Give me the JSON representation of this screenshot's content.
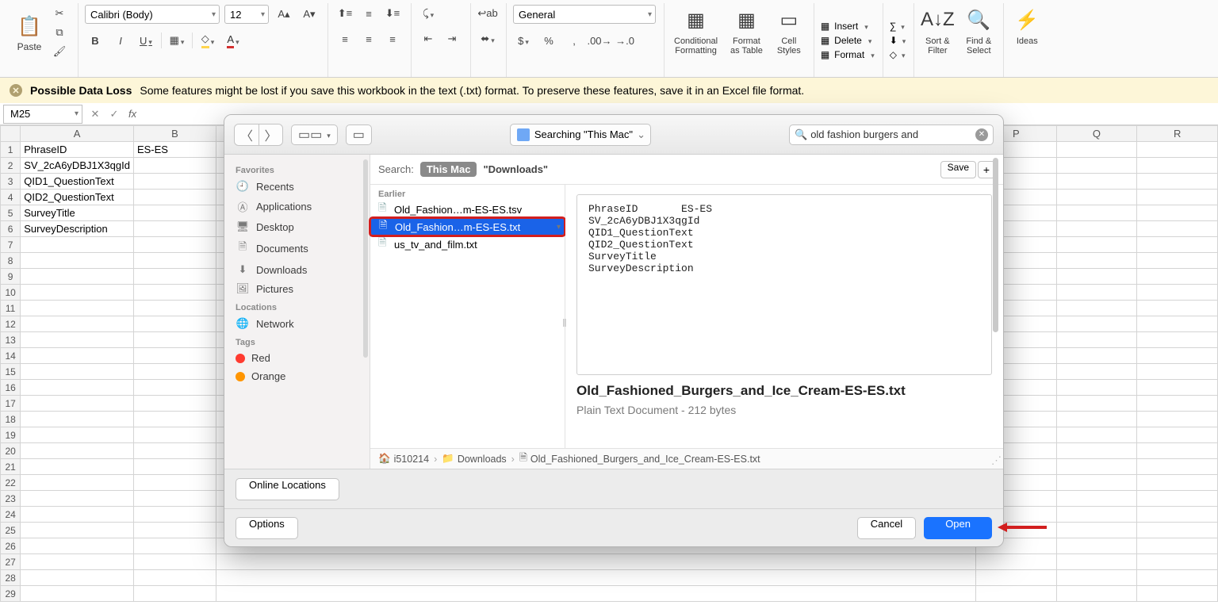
{
  "ribbon": {
    "paste": "Paste",
    "font_name": "Calibri (Body)",
    "font_size": "12",
    "number_format": "General",
    "cond_fmt": "Conditional\nFormatting",
    "fmt_table": "Format\nas Table",
    "cell_styles": "Cell\nStyles",
    "insert": "Insert",
    "delete": "Delete",
    "format": "Format",
    "sort_filter": "Sort &\nFilter",
    "find_select": "Find &\nSelect",
    "ideas": "Ideas"
  },
  "warning": {
    "title": "Possible Data Loss",
    "text": "Some features might be lost if you save this workbook in the text (.txt) format. To preserve these features, save it in an Excel file format."
  },
  "formula": {
    "cell_ref": "M25"
  },
  "sheet": {
    "columns_first": [
      "A",
      "B"
    ],
    "columns_rest": [
      "P",
      "Q",
      "R"
    ],
    "rows": [
      [
        "PhraseID",
        "ES-ES"
      ],
      [
        "SV_2cA6yDBJ1X3qgId",
        ""
      ],
      [
        "QID1_QuestionText",
        ""
      ],
      [
        "QID2_QuestionText",
        ""
      ],
      [
        "SurveyTitle",
        ""
      ],
      [
        "SurveyDescription",
        ""
      ]
    ]
  },
  "dialog": {
    "location": "Searching \"This Mac\"",
    "search_value": "old fashion burgers and",
    "scope_label": "Search:",
    "scope_thismac": "This Mac",
    "scope_downloads": "\"Downloads\"",
    "save": "Save",
    "sidebar": {
      "favorites": "Favorites",
      "items_fav": [
        "Recents",
        "Applications",
        "Desktop",
        "Documents",
        "Downloads",
        "Pictures"
      ],
      "locations": "Locations",
      "items_loc": [
        "Network"
      ],
      "tags": "Tags",
      "tag_red": "Red",
      "tag_orange": "Orange"
    },
    "files_header": "Earlier",
    "files": [
      "Old_Fashion…m-ES-ES.tsv",
      "Old_Fashion…m-ES-ES.txt",
      "us_tv_and_film.txt"
    ],
    "preview_text": "PhraseID       ES-ES\nSV_2cA6yDBJ1X3qgId\nQID1_QuestionText\nQID2_QuestionText\nSurveyTitle\nSurveyDescription",
    "preview_filename": "Old_Fashioned_Burgers_and_Ice_Cream-ES-ES.txt",
    "preview_sub": "Plain Text Document - 212 bytes",
    "path": [
      "i510214",
      "Downloads",
      "Old_Fashioned_Burgers_and_Ice_Cream-ES-ES.txt"
    ],
    "online_locations": "Online Locations",
    "options": "Options",
    "cancel": "Cancel",
    "open": "Open"
  }
}
